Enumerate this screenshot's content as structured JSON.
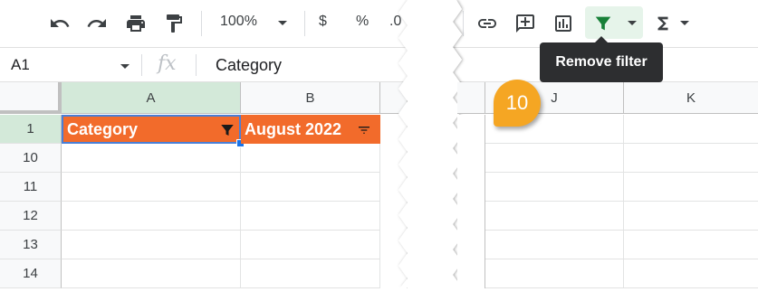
{
  "toolbar": {
    "zoom": "100%",
    "currency": "$",
    "percent": "%",
    "decimal": ".0"
  },
  "formula_bar": {
    "cell_ref": "A1",
    "fx": "fx",
    "value": "Category"
  },
  "columns": [
    "A",
    "B",
    "J",
    "K"
  ],
  "rows": [
    "1",
    "10",
    "11",
    "12",
    "13",
    "14"
  ],
  "header_cells": {
    "a1": "Category",
    "b1": "August 2022"
  },
  "tooltip": "Remove filter",
  "step_badge": "10",
  "colors": {
    "header_fill": "#f26b2b",
    "selected_header": "#d3e9d9",
    "filter_active": "#188038",
    "badge": "#f5a623"
  }
}
